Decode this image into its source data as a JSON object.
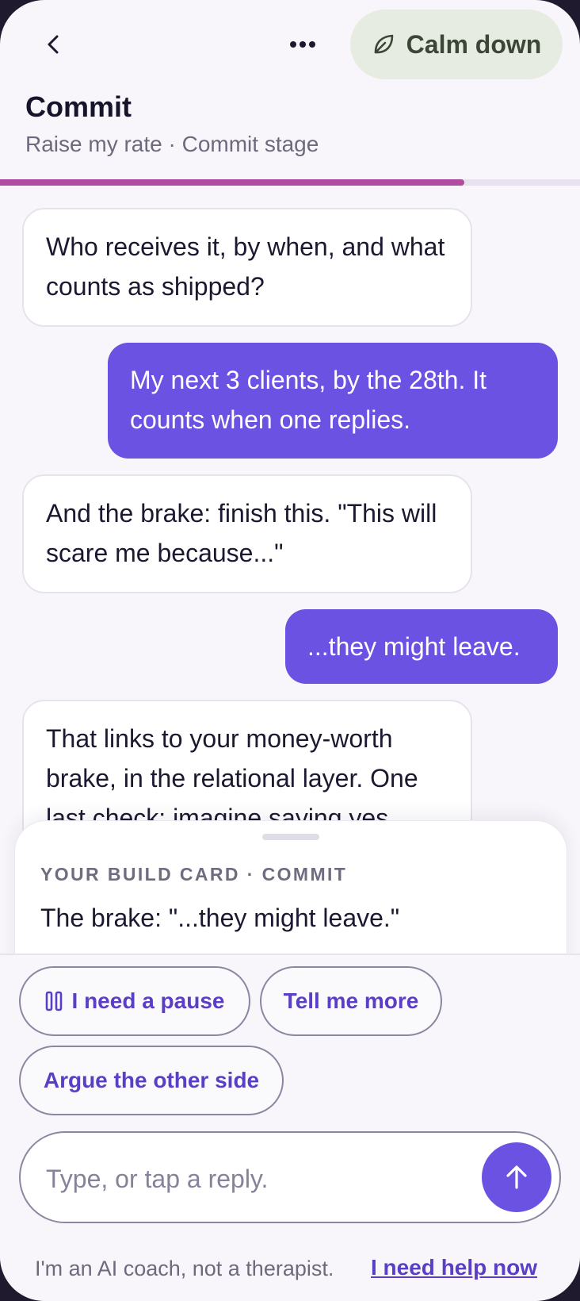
{
  "header": {
    "back_icon": "chevron-left-icon",
    "more_icon": "ellipsis-icon",
    "calm_icon": "leaf-icon",
    "calm_label": "Calm down",
    "title": "Commit",
    "subtitle": "Raise my rate · Commit stage",
    "progress": 0.8,
    "progress_color": "#b04ba0"
  },
  "messages": [
    {
      "role": "coach",
      "text": "Who receives it, by when, and what counts as shipped?"
    },
    {
      "role": "user",
      "text": "My next 3 clients, by the 28th. It counts when one replies."
    },
    {
      "role": "coach",
      "text": "And the brake: finish this. \"This will scare me because...\""
    },
    {
      "role": "user",
      "text": "...they might leave."
    },
    {
      "role": "coach",
      "text": "That links to your money-worth brake, in the relational layer. One last check: imagine saying yes"
    }
  ],
  "build_card": {
    "heading": "YOUR BUILD CARD · COMMIT",
    "text": "The brake: \"...they might leave.\""
  },
  "quick_replies": {
    "pause_icon": "pause-icon",
    "pause_label": "I need a pause",
    "more_label": "Tell me more",
    "argue_label": "Argue the other side"
  },
  "composer": {
    "placeholder": "Type, or tap a reply.",
    "value": "",
    "send_icon": "arrow-up-icon"
  },
  "footer": {
    "disclaimer": "I'm an AI coach, not a therapist.",
    "help_link": "I need help now"
  },
  "colors": {
    "accent": "#6b52e3",
    "calm_bg": "#e6ece2",
    "progress": "#b04ba0"
  }
}
